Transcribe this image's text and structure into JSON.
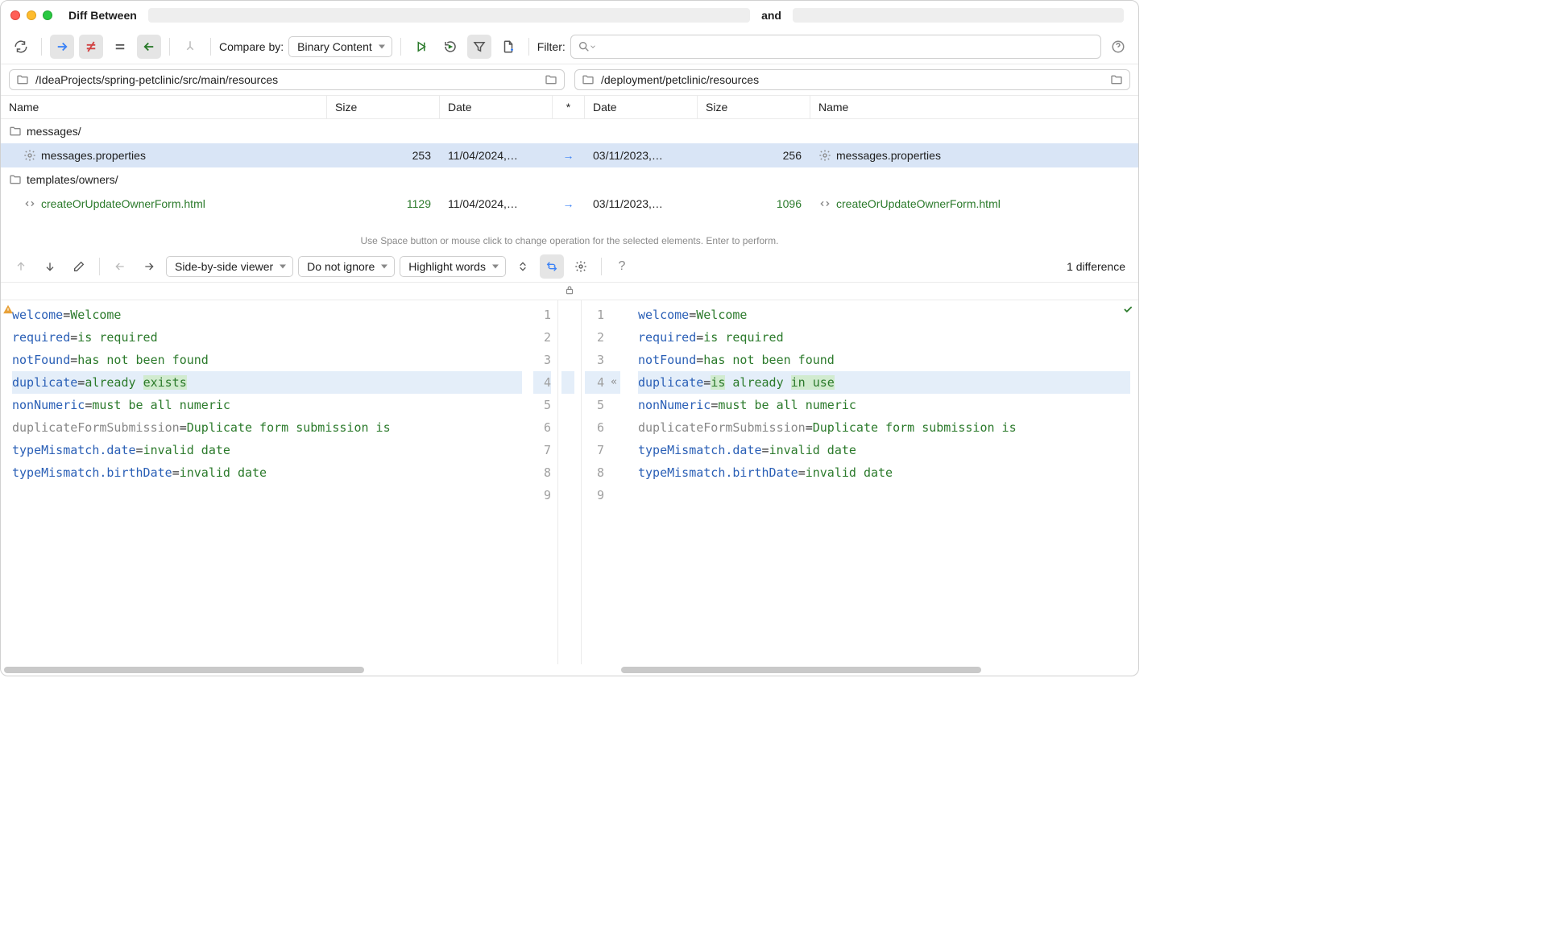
{
  "window": {
    "title_prefix": "Diff Between",
    "title_and": "and"
  },
  "topbar": {
    "compare_by_label": "Compare by:",
    "compare_by_value": "Binary Content",
    "filter_label": "Filter:"
  },
  "paths": {
    "left": "/IdeaProjects/spring-petclinic/src/main/resources",
    "right": "/deployment/petclinic/resources"
  },
  "tree": {
    "headers": {
      "name": "Name",
      "size": "Size",
      "date": "Date",
      "op": "*"
    },
    "rows": [
      {
        "type": "folder",
        "name_l": "messages/",
        "name_r": "",
        "size_l": "",
        "date_l": "",
        "op": "",
        "date_r": "",
        "size_r": ""
      },
      {
        "type": "file",
        "selected": true,
        "icon": "gear",
        "name_l": "messages.properties",
        "name_r": "messages.properties",
        "size_l": "253",
        "date_l": "11/04/2024,…",
        "op": "→",
        "date_r": "03/11/2023,…",
        "size_r": "256"
      },
      {
        "type": "folder",
        "name_l": "templates/owners/",
        "name_r": "",
        "size_l": "",
        "date_l": "",
        "op": "",
        "date_r": "",
        "size_r": ""
      },
      {
        "type": "file",
        "modified": true,
        "icon": "tag",
        "name_l": "createOrUpdateOwnerForm.html",
        "name_r": "createOrUpdateOwnerForm.html",
        "size_l": "1129",
        "date_l": "11/04/2024,…",
        "op": "→",
        "date_r": "03/11/2023,…",
        "size_r": "1096"
      }
    ]
  },
  "hint": "Use Space button or mouse click to change operation for the selected elements. Enter to perform.",
  "diffbar": {
    "viewer_mode": "Side-by-side viewer",
    "ignore_mode": "Do not ignore",
    "highlight_mode": "Highlight words",
    "count": "1 difference"
  },
  "code": {
    "left": [
      {
        "n": "1",
        "key": "welcome",
        "val": "Welcome"
      },
      {
        "n": "2",
        "key": "required",
        "val": "is required"
      },
      {
        "n": "3",
        "key": "notFound",
        "val": "has not been found"
      },
      {
        "n": "4",
        "key": "duplicate",
        "val_parts": [
          [
            "already",
            ""
          ],
          [
            " ",
            ""
          ],
          [
            "exists",
            "hl"
          ]
        ],
        "diff": true
      },
      {
        "n": "5",
        "key": "nonNumeric",
        "val": "must be all numeric"
      },
      {
        "n": "6",
        "key": "duplicateFormSubmission",
        "val": "Duplicate form submission is",
        "gray_key": true
      },
      {
        "n": "7",
        "key": "typeMismatch.date",
        "val": "invalid date"
      },
      {
        "n": "8",
        "key": "typeMismatch.birthDate",
        "val": "invalid date"
      },
      {
        "n": "9",
        "key": "",
        "val": ""
      }
    ],
    "right": [
      {
        "n": "1",
        "key": "welcome",
        "val": "Welcome"
      },
      {
        "n": "2",
        "key": "required",
        "val": "is required"
      },
      {
        "n": "3",
        "key": "notFound",
        "val": "has not been found"
      },
      {
        "n": "4",
        "key": "duplicate",
        "val_parts": [
          [
            "is",
            "hl"
          ],
          [
            " already ",
            ""
          ],
          [
            "in use",
            "hl"
          ]
        ],
        "diff": true,
        "apply": "«"
      },
      {
        "n": "5",
        "key": "nonNumeric",
        "val": "must be all numeric"
      },
      {
        "n": "6",
        "key": "duplicateFormSubmission",
        "val": "Duplicate form submission is",
        "gray_key": true
      },
      {
        "n": "7",
        "key": "typeMismatch.date",
        "val": "invalid date"
      },
      {
        "n": "8",
        "key": "typeMismatch.birthDate",
        "val": "invalid date"
      },
      {
        "n": "9",
        "key": "",
        "val": ""
      }
    ]
  }
}
